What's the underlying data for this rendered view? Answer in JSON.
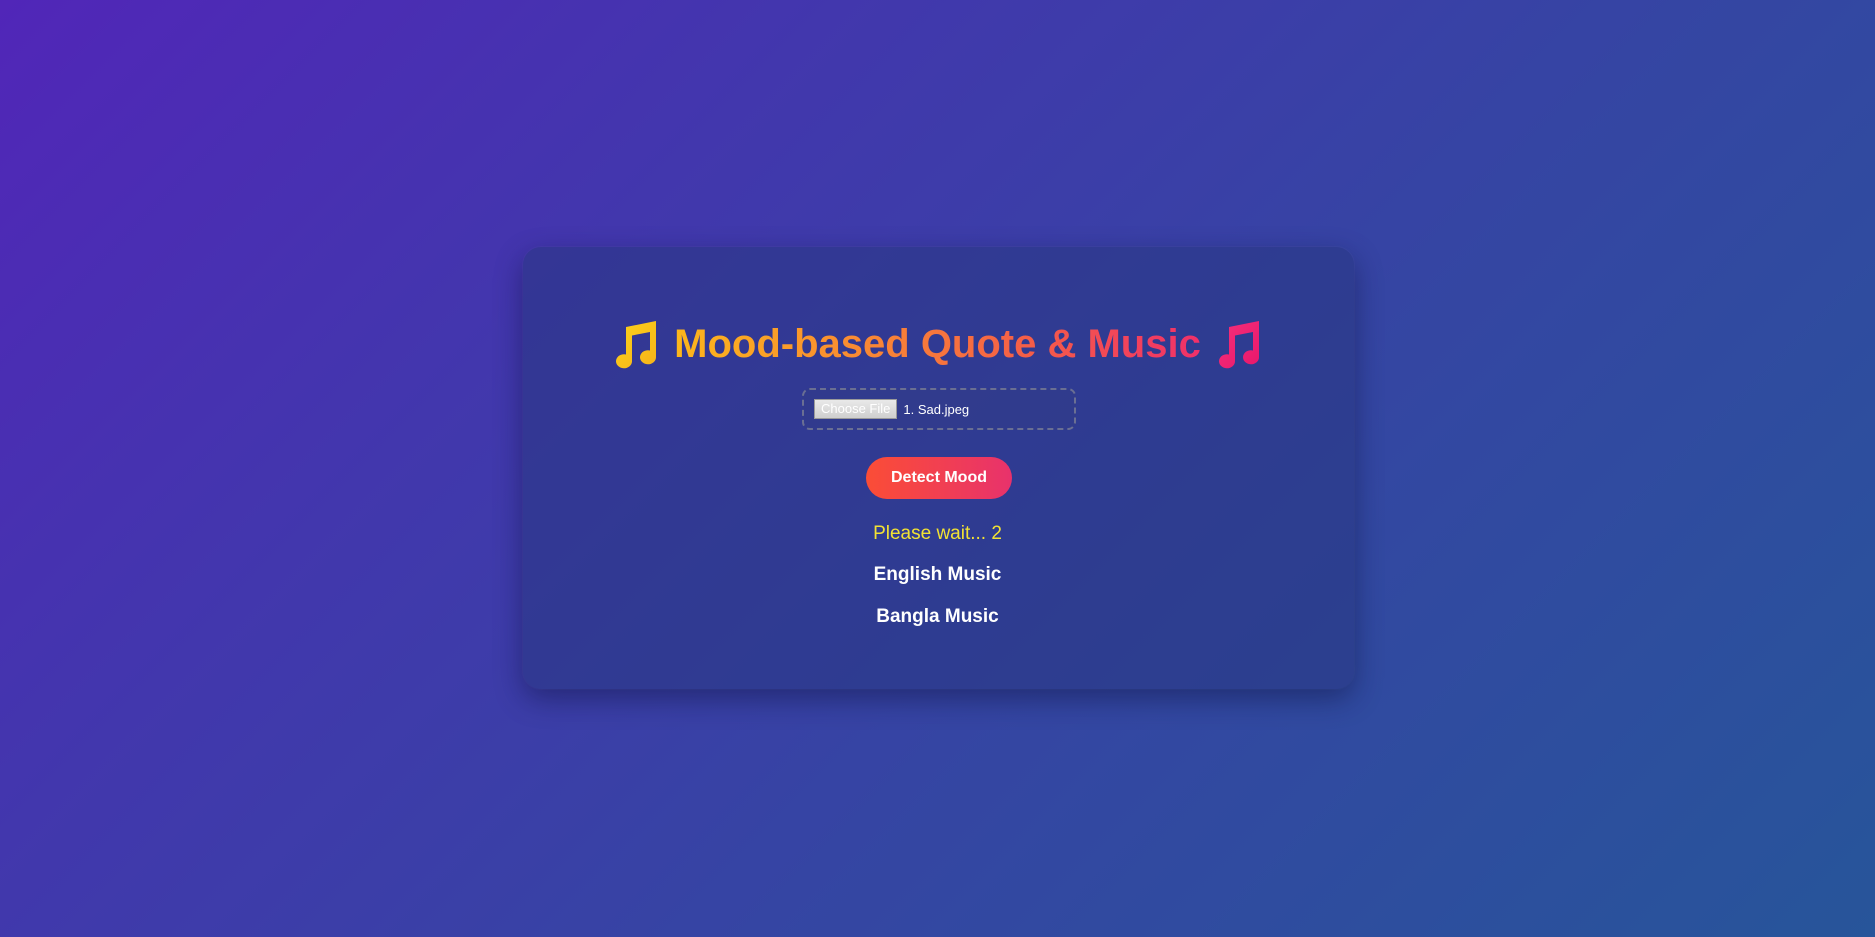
{
  "header": {
    "title": "Mood-based Quote & Music",
    "left_icon": "music-note-icon",
    "right_icon": "music-note-icon"
  },
  "upload": {
    "button_label": "Choose File",
    "file_name": "1. Sad.jpeg"
  },
  "actions": {
    "detect_label": "Detect Mood"
  },
  "status": {
    "text": "Please wait... 2"
  },
  "sections": {
    "english_title": "English Music",
    "bangla_title": "Bangla Music"
  },
  "colors": {
    "title_gradient_start": "#fcb71b",
    "title_gradient_end": "#f0306a",
    "button_gradient_start": "#fb4d36",
    "button_gradient_end": "#e8326c",
    "status_color": "#f2e233"
  }
}
